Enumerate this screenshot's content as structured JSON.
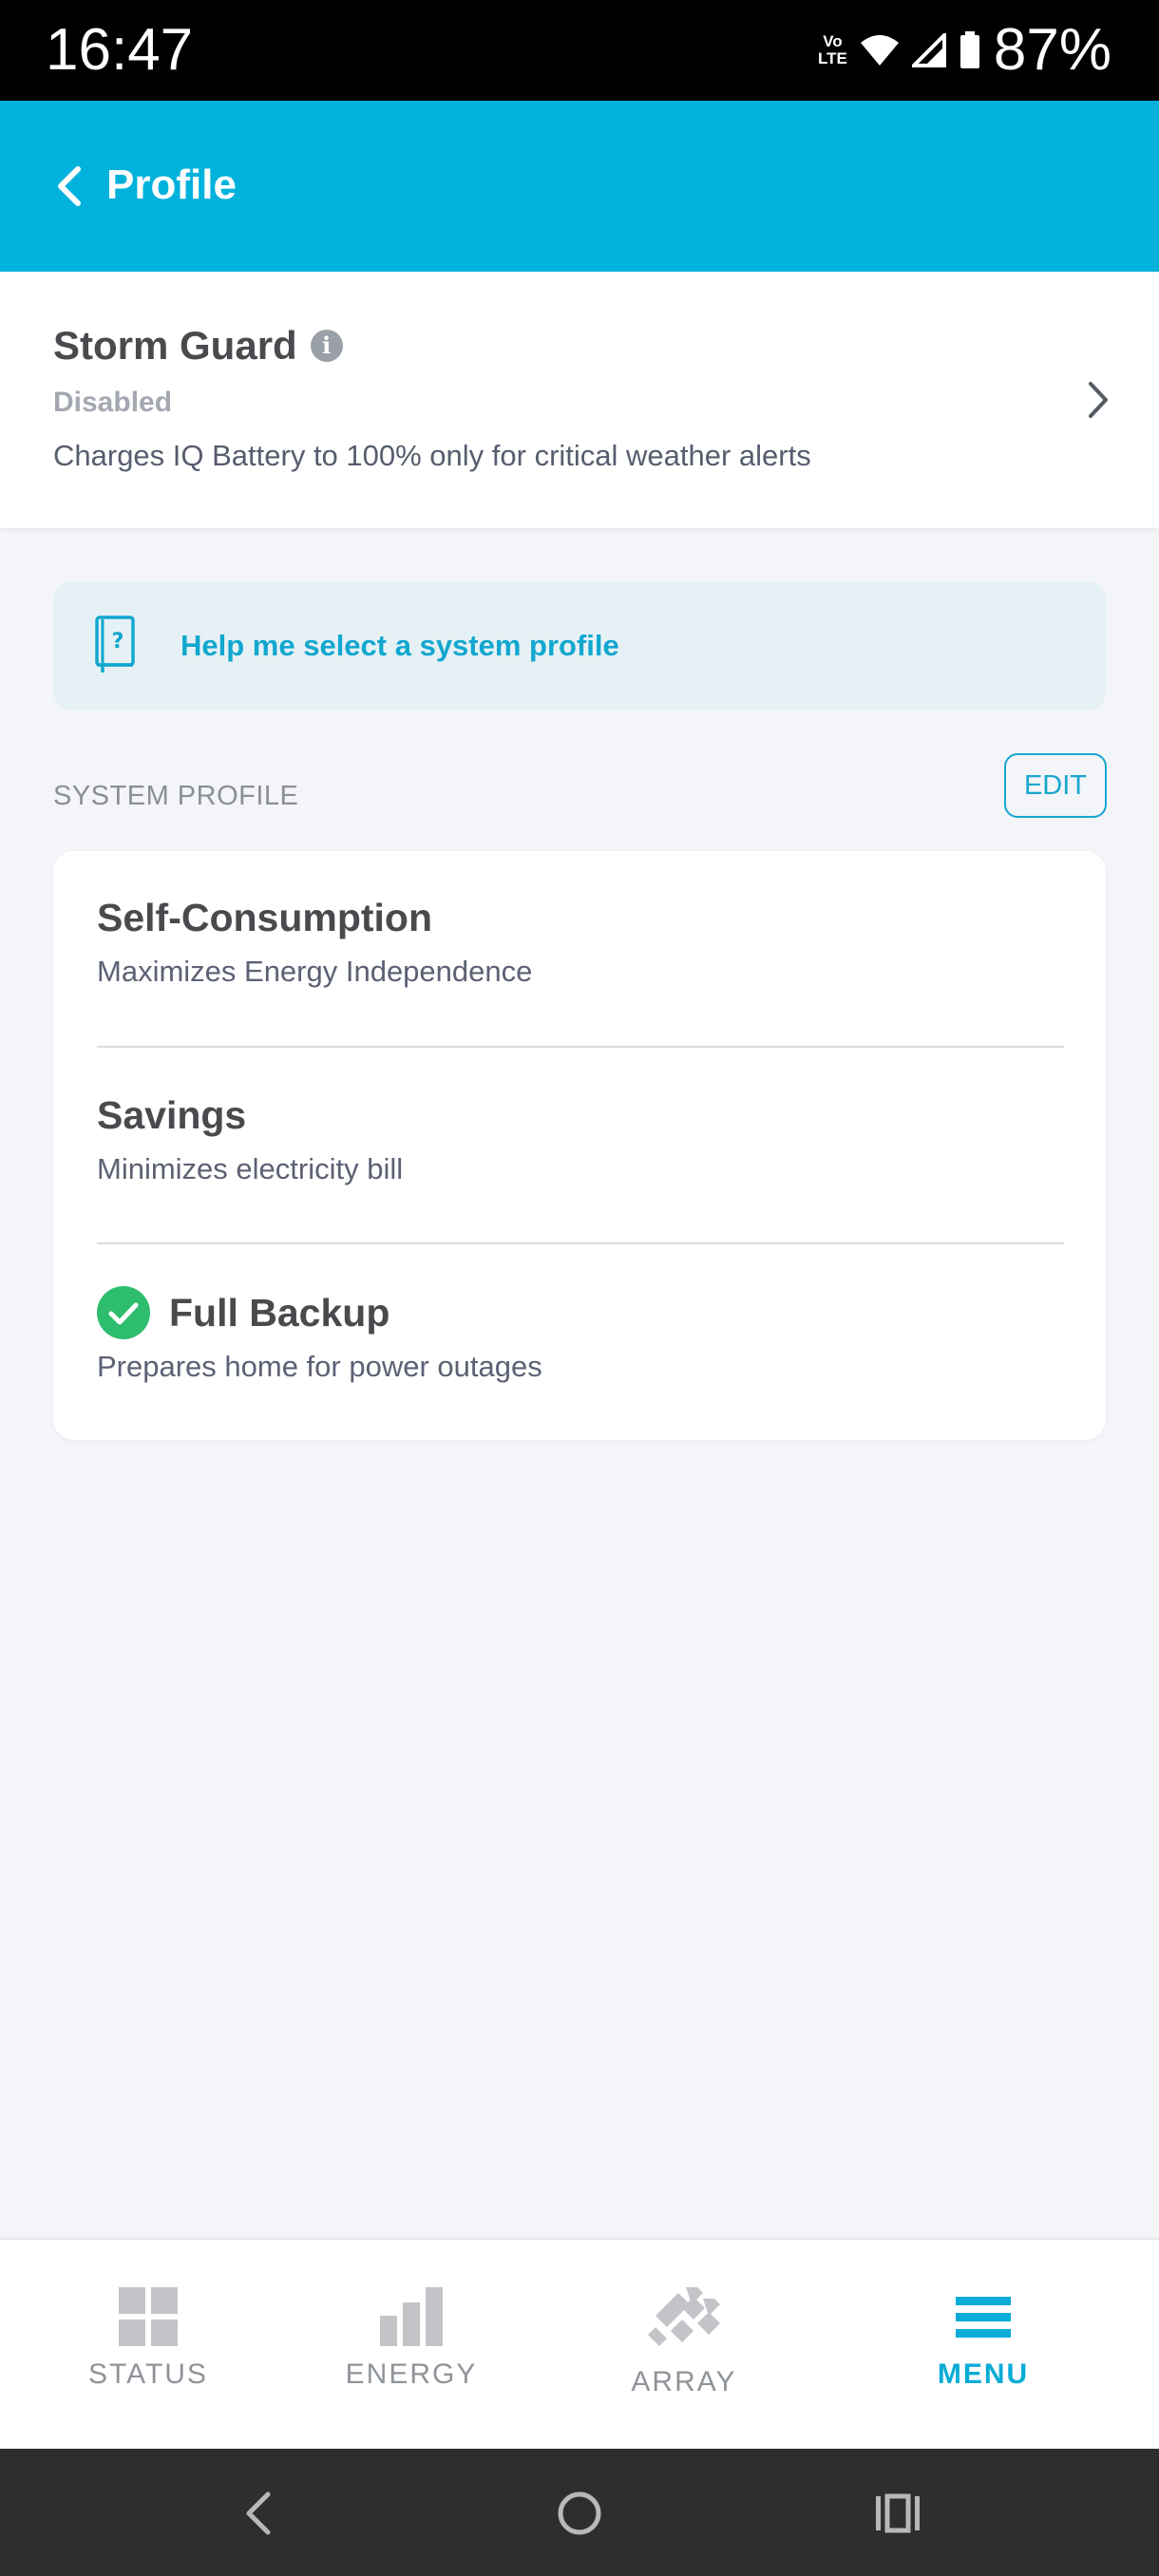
{
  "status_bar": {
    "time": "16:47",
    "volte_top": "Vo",
    "volte_bottom": "LTE",
    "battery_percent": "87%",
    "icons": [
      "volte-icon",
      "wifi-icon",
      "signal-icon",
      "battery-icon"
    ]
  },
  "header": {
    "title": "Profile",
    "background_color": "#00b2dc"
  },
  "storm_guard": {
    "title": "Storm Guard",
    "status": "Disabled",
    "description": "Charges IQ Battery to 100% only for critical weather alerts",
    "info_glyph": "i"
  },
  "help": {
    "text": "Help me select a system profile",
    "icon_glyph": "?"
  },
  "system_profile": {
    "section_label": "SYSTEM PROFILE",
    "edit_label": "EDIT",
    "options": [
      {
        "title": "Self-Consumption",
        "description": "Maximizes Energy Independence",
        "selected": false
      },
      {
        "title": "Savings",
        "description": "Minimizes electricity bill",
        "selected": false
      },
      {
        "title": "Full Backup",
        "description": "Prepares home for power outages",
        "selected": true
      }
    ],
    "selected_color": "#2ebd6e"
  },
  "bottom_nav": {
    "items": [
      {
        "label": "STATUS",
        "icon": "status-grid-icon",
        "active": false
      },
      {
        "label": "ENERGY",
        "icon": "energy-bars-icon",
        "active": false
      },
      {
        "label": "ARRAY",
        "icon": "array-panels-icon",
        "active": false
      },
      {
        "label": "MENU",
        "icon": "menu-hamburger-icon",
        "active": true
      }
    ],
    "active_color": "#08acd6"
  },
  "system_nav": {
    "icons": [
      "back-icon",
      "home-icon",
      "recents-icon"
    ]
  }
}
